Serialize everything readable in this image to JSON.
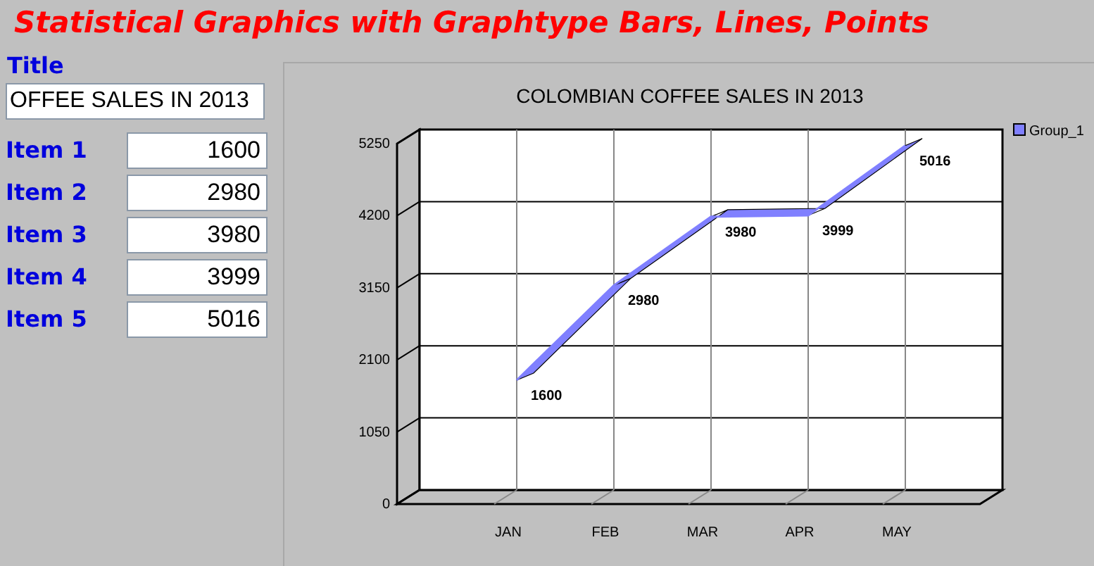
{
  "heading": "Statistical Graphics with Graphtype Bars, Lines, Points",
  "form": {
    "title_label": "Title",
    "title_value": "OFFEE SALES IN 2013",
    "items": [
      {
        "label": "Item 1",
        "value": "1600"
      },
      {
        "label": "Item 2",
        "value": "2980"
      },
      {
        "label": "Item 3",
        "value": "3980"
      },
      {
        "label": "Item 4",
        "value": "3999"
      },
      {
        "label": "Item 5",
        "value": "5016"
      }
    ]
  },
  "chart": {
    "chart_data": {
      "type": "line",
      "title": "COLOMBIAN COFFEE SALES IN 2013",
      "categories": [
        "JAN",
        "FEB",
        "MAR",
        "APR",
        "MAY"
      ],
      "series": [
        {
          "name": "Group_1",
          "color": "#8080ff",
          "values": [
            1600,
            2980,
            3980,
            3999,
            5016
          ]
        }
      ],
      "ylim": [
        0,
        5250
      ],
      "yticks": [
        0,
        1050,
        2100,
        3150,
        4200,
        5250
      ],
      "data_labels": true,
      "grid": true
    }
  }
}
